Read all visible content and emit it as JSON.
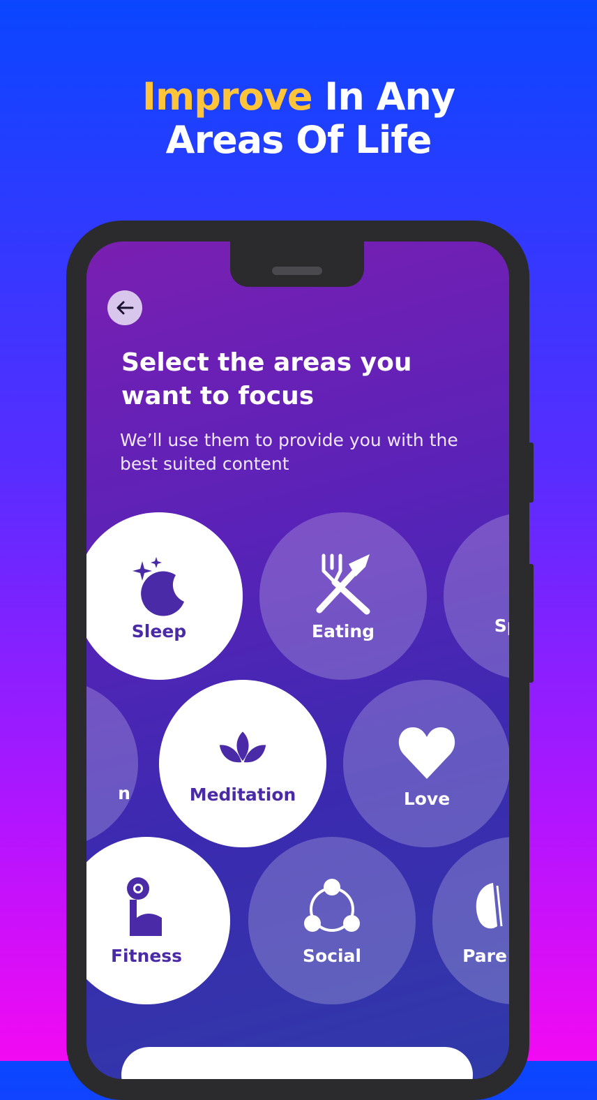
{
  "headline": {
    "accent": "Improve",
    "line1_rest": " In Any",
    "line2": "Areas Of Life"
  },
  "screen": {
    "title": "Select the areas you want to focus",
    "subtitle": "We’ll use them to provide you with the best suited content"
  },
  "areas": [
    {
      "label": "Sleep",
      "icon": "moon-stars-icon",
      "selected": true
    },
    {
      "label": "Eating",
      "icon": "fork-knife-icon",
      "selected": false
    },
    {
      "label": "Spi",
      "icon": "none",
      "selected": false
    },
    {
      "label": "n",
      "icon": "none",
      "selected": false
    },
    {
      "label": "Meditation",
      "icon": "lotus-icon",
      "selected": true
    },
    {
      "label": "Love",
      "icon": "heart-icon",
      "selected": false
    },
    {
      "label": "Fitness",
      "icon": "dumbbell-arm-icon",
      "selected": true
    },
    {
      "label": "Social",
      "icon": "network-icon",
      "selected": false
    },
    {
      "label": "Pare",
      "icon": "parenting-icon",
      "selected": false
    }
  ],
  "colors": {
    "accent": "#ffc43a",
    "selected_text": "#4b2aa8"
  }
}
